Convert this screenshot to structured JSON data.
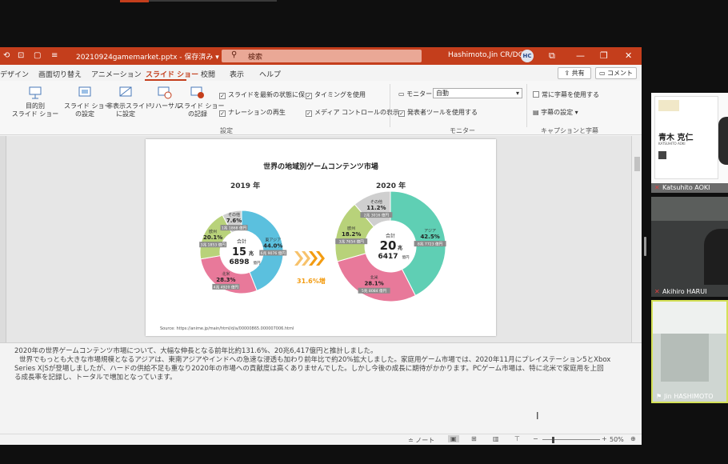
{
  "titlebar": {
    "filename": "20210924gamemarket.pptx",
    "save_status": "保存済み",
    "search_placeholder": "検索",
    "user_name": "Hashimoto,Jin CR/DG",
    "user_initials": "HC"
  },
  "tabs": [
    "デザイン",
    "画面切り替え",
    "アニメーション",
    "スライド ショー",
    "校閲",
    "表示",
    "ヘルプ"
  ],
  "active_tab": "スライド ショー",
  "share_label": "共有",
  "comment_label": "コメント",
  "ribbon": {
    "custom_show": "目的別\nスライド ショー",
    "setup_show": "スライド ショー\nの設定",
    "hide_slide": "非表示スライド\nに設定",
    "rehearse": "リハーサル",
    "record": "スライド ショー\nの記録",
    "keep_updated": "スライドを最新の状態に保つ",
    "play_narrations": "ナレーションの再生",
    "use_timings": "タイミングを使用",
    "show_media": "メディア コントロールの表示",
    "setup_group": "設定",
    "monitor_label": "モニター:",
    "monitor_value": "自動",
    "presenter_view": "発表者ツールを使用する",
    "monitor_group": "モニター",
    "always_subtitles": "常に字幕を使用する",
    "subtitle_settings": "字幕の設定",
    "captions_group": "キャプションと字幕"
  },
  "slide": {
    "title": "世界の地域別ゲームコンテンツ市場",
    "year_2019": "2019 年",
    "year_2020": "2020 年",
    "growth": "31.6%増",
    "total_2019_label": "合計",
    "total_2019_big": "15",
    "total_2019_unit": "兆",
    "total_2019_small": "6898",
    "total_2020_label": "合計",
    "total_2020_big": "20",
    "total_2020_unit": "兆",
    "total_2020_small": "6417",
    "oku": "億円",
    "source": "Source: https://anime.jp/main/html/d/a/00000865.000007006.html"
  },
  "chart_data": [
    {
      "type": "pie",
      "title": "2019 年",
      "categories": [
        "東アジア",
        "北米",
        "欧州",
        "その他"
      ],
      "values": [
        44.0,
        28.3,
        20.1,
        7.6
      ],
      "amounts": [
        "6兆 9076 億円",
        "4兆 4920 億円",
        "3兆 1853 億円",
        "1兆 1868 億円"
      ],
      "colors": [
        "#5bc0de",
        "#e8799a",
        "#b8d27a",
        "#cfcfcf"
      ]
    },
    {
      "type": "pie",
      "title": "2020 年",
      "categories": [
        "アジア",
        "北米",
        "欧州",
        "その他"
      ],
      "values": [
        42.5,
        28.1,
        18.2,
        11.2
      ],
      "amounts": [
        "8兆 7723 億円",
        "5兆 8084 億円",
        "3兆 7654 億円",
        "2兆 3016 億円"
      ],
      "colors": [
        "#5fcfb4",
        "#e8799a",
        "#b8d27a",
        "#cfcfcf"
      ]
    }
  ],
  "notes": {
    "line1": "2020年の世界ゲームコンテンツ市場について、大幅な伸長となる前年比約131.6%、20兆6,417億円と推計しました。",
    "line2": "世界でもっとも大きな市場規模となるアジアは、東南アジアやインドへの急速な浸透も加わり前年比で約20%拡大しました。家庭用ゲーム市場では、2020年11月にプレイステーション5とXbox",
    "line3": "Series X|Sが登場しましたが、ハードの供給不足も重なり2020年の市場への貢献度は高くありませんでした。しかし今後の成長に期待がかかります。PCゲーム市場は、特に北米で家庭用を上回",
    "line4": "る成長率を記録し、トータルで増加となっています。"
  },
  "statusbar": {
    "notes_label": "ノート",
    "zoom": "50%"
  },
  "participants": [
    {
      "name": "Katsuhito AOKI",
      "card_name": "青木 克仁",
      "card_romaji": "KATSUHITO AOKI"
    },
    {
      "name": "Akihiro HARUI"
    },
    {
      "name": "Jin HASHIMOTO"
    }
  ]
}
